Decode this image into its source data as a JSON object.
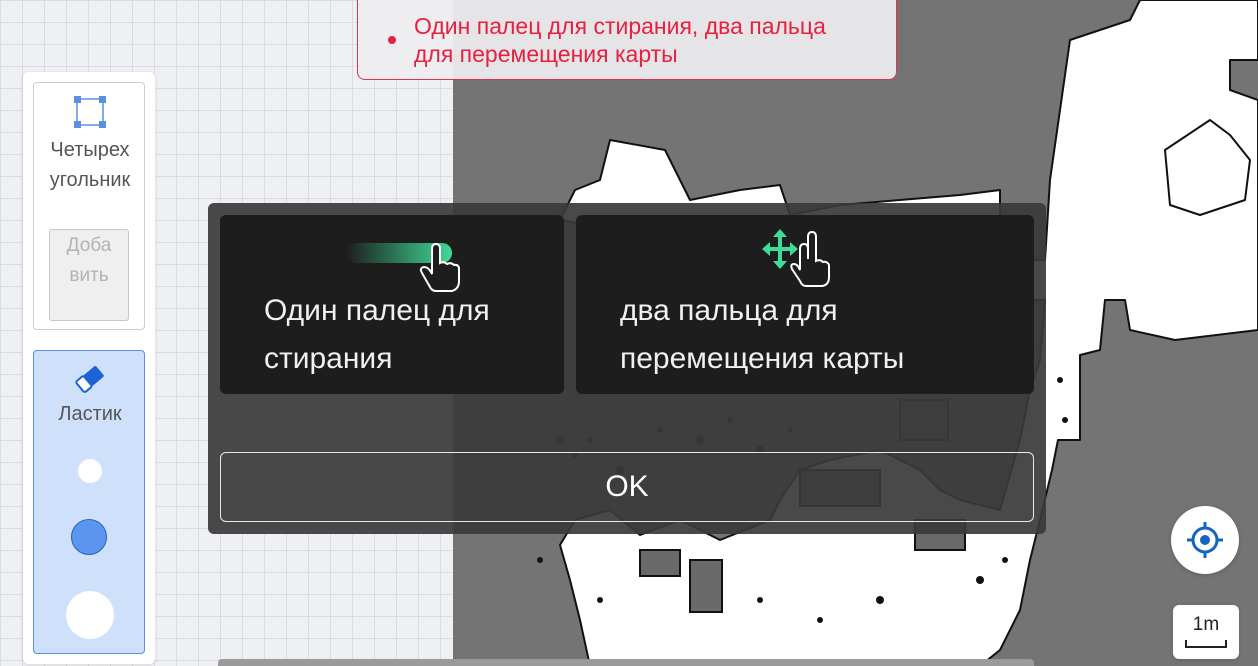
{
  "hint": {
    "text": "Один палец для стирания, два пальца для перемещения карты",
    "color": "#e8203f"
  },
  "toolbar": {
    "rectangle": {
      "icon": "rectangle-select-icon",
      "label": "Четырехугольник",
      "add_button": "Добавить"
    },
    "eraser": {
      "icon": "eraser-icon",
      "label": "Ластик",
      "sizes": [
        "small",
        "medium",
        "large"
      ],
      "selected_size": "medium"
    }
  },
  "modal": {
    "tips": [
      {
        "icon": "one-finger-swipe-icon",
        "text": "Один палец для стирания"
      },
      {
        "icon": "two-finger-move-icon",
        "text": "два пальца для перемещения карты"
      }
    ],
    "ok_label": "OK",
    "accent_color": "#3ddc97"
  },
  "controls": {
    "locate_icon": "crosshair-icon",
    "scale_label": "1m",
    "accent_color": "#1565c0"
  }
}
